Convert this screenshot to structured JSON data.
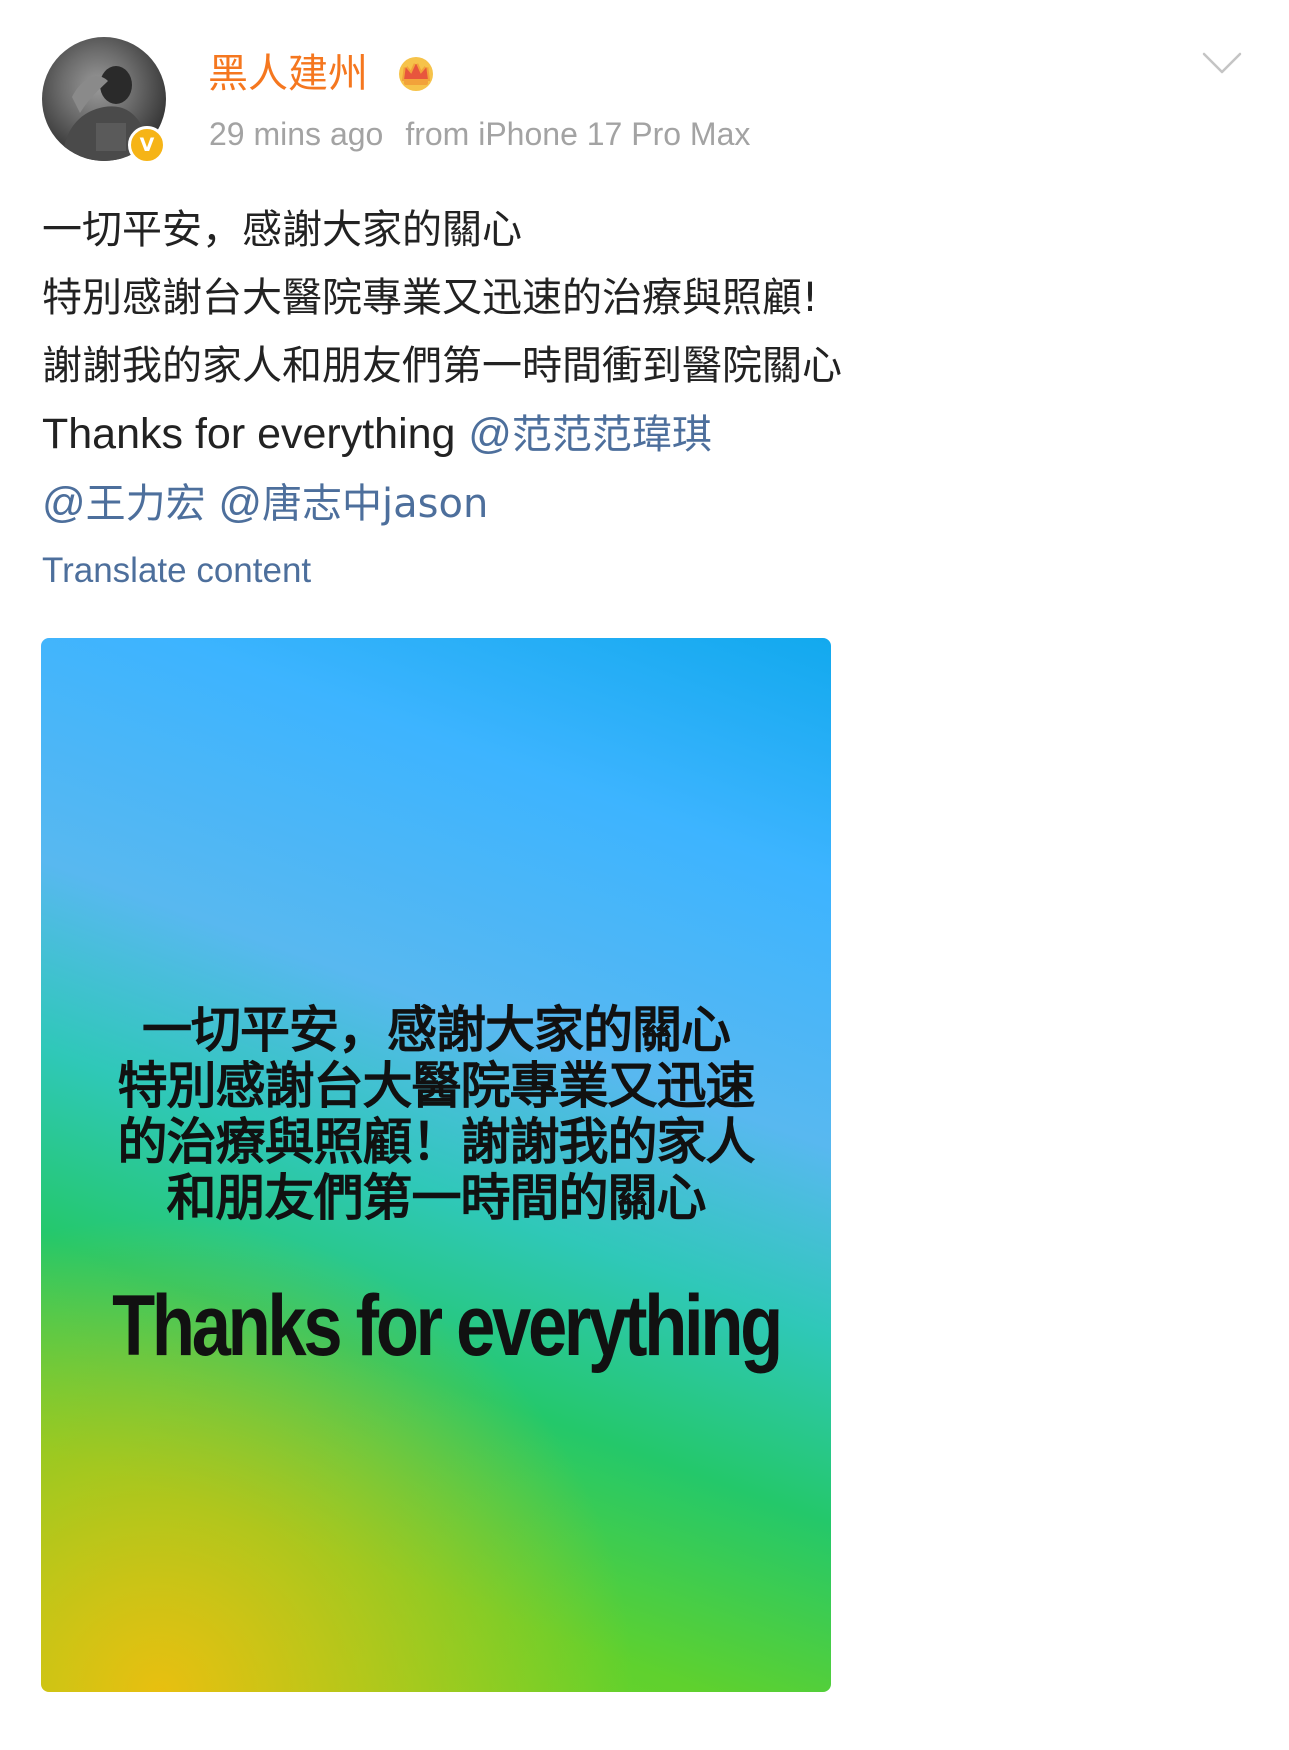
{
  "post": {
    "author": {
      "name": "黑人建州",
      "avatar_icon": "user-avatar",
      "verified_badge": "V",
      "badge_color": "#f6b416",
      "crown_icon": "crown-icon",
      "name_color": "#f5771f"
    },
    "meta": {
      "time": "29 mins ago",
      "source": "from iPhone 17 Pro Max"
    },
    "more_icon": "chevron-down-icon",
    "text": {
      "line1": "一切平安，感謝大家的關心",
      "line2": "特別感謝台大醫院專業又迅速的治療與照顧!",
      "line3": "謝謝我的家人和朋友們第一時間衝到醫院關心",
      "line4_prefix": "Thanks for everything",
      "mentions": [
        {
          "at": "@",
          "name": "范范范瑋琪"
        },
        {
          "at": "@",
          "name": "王力宏"
        },
        {
          "at": "@",
          "name": "唐志中jason"
        }
      ]
    },
    "translate_label": "Translate content",
    "image": {
      "lines_cn": [
        "一切平安，感謝大家的關心",
        "特別感謝台大醫院專業又迅速",
        "的治療與照顧！謝謝我的家人",
        "和朋友們第一時間的關心"
      ],
      "line_en": "Thanks for everything"
    },
    "colors": {
      "link": "#4d6f9c",
      "meta": "#a3a3a3",
      "body": "#222222"
    }
  }
}
